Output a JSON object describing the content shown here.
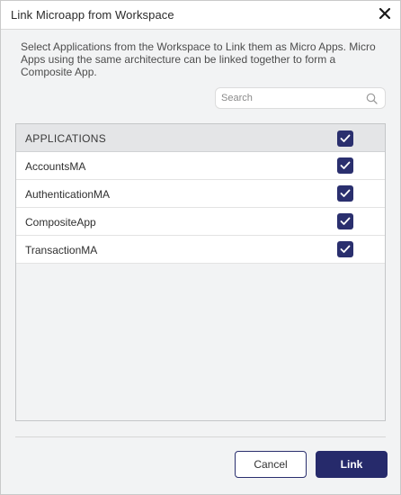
{
  "dialog": {
    "title": "Link Microapp from Workspace",
    "close_icon": "close-icon",
    "description": "Select Applications from the Workspace to Link them as Micro Apps. Micro Apps using the same architecture can be linked together to form a Composite App."
  },
  "search": {
    "placeholder": "Search",
    "value": "",
    "icon": "search-icon"
  },
  "table": {
    "header": "APPLICATIONS",
    "select_all_checked": true,
    "rows": [
      {
        "label": "AccountsMA",
        "checked": true
      },
      {
        "label": "AuthenticationMA",
        "checked": true
      },
      {
        "label": "CompositeApp",
        "checked": true
      },
      {
        "label": "TransactionMA",
        "checked": true
      }
    ]
  },
  "footer": {
    "cancel_label": "Cancel",
    "link_label": "Link"
  },
  "colors": {
    "accent": "#262a6b",
    "background": "#f2f3f4",
    "header_bg": "#e4e5e7"
  }
}
